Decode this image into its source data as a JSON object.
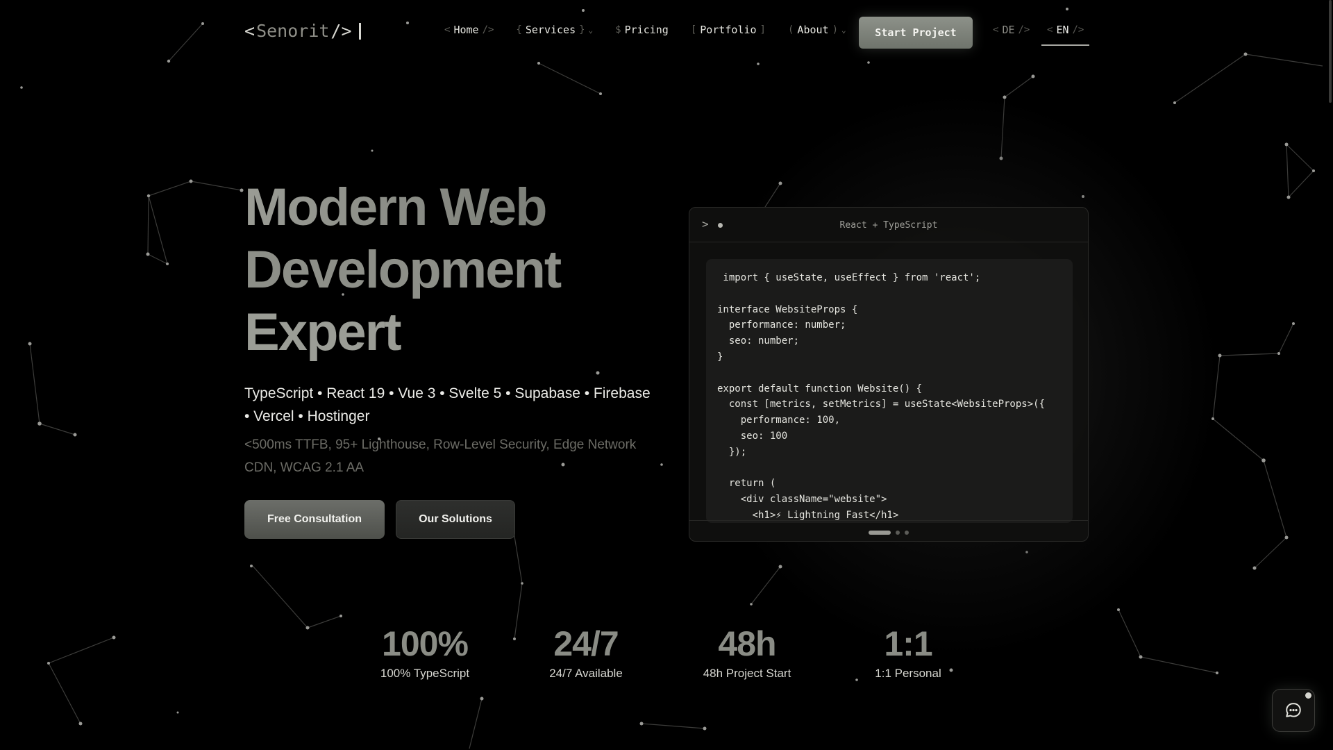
{
  "logo": {
    "open": "<",
    "name": "Senorit",
    "close": "/>"
  },
  "nav": {
    "items": [
      {
        "pre": "<",
        "label": "Home",
        "post": "/>"
      },
      {
        "pre": "{",
        "label": "Services",
        "post": "}"
      },
      {
        "pre": "$",
        "label": "Pricing",
        "post": ""
      },
      {
        "pre": "[",
        "label": "Portfolio",
        "post": "]"
      },
      {
        "pre": "(",
        "label": "About",
        "post": ")"
      }
    ],
    "cta": "Start Project",
    "lang": [
      {
        "pre": "<",
        "label": "DE",
        "post": "/>"
      },
      {
        "pre": "<",
        "label": "EN",
        "post": "/>"
      }
    ]
  },
  "hero": {
    "title_lines": [
      "Modern Web",
      "Development",
      "Expert"
    ],
    "tech": "TypeScript • React 19 • Vue 3 • Svelte 5 • Supabase • Firebase • Vercel • Hostinger",
    "metrics": "<500ms TTFB, 95+ Lighthouse, Row-Level Security, Edge Network CDN, WCAG 2.1 AA",
    "primary_button": "Free Consultation",
    "secondary_button": "Our Solutions"
  },
  "code": {
    "chevron": ">",
    "title": "React + TypeScript",
    "lines": [
      " import { useState, useEffect } from 'react';",
      "",
      "interface WebsiteProps {",
      "  performance: number;",
      "  seo: number;",
      "}",
      "",
      "export default function Website() {",
      "  const [metrics, setMetrics] = useState<WebsiteProps>({",
      "    performance: 100,",
      "    seo: 100",
      "  });",
      "",
      "  return (",
      "    <div className=\"website\">",
      "      <h1>⚡ Lightning Fast</h1>"
    ]
  },
  "stats": [
    {
      "value": "100%",
      "label": "100% TypeScript"
    },
    {
      "value": "24/7",
      "label": "24/7 Available"
    },
    {
      "value": "48h",
      "label": "48h Project Start"
    },
    {
      "value": "1:1",
      "label": "1:1 Personal"
    }
  ],
  "icons": {
    "chat": "chat-bubble-icon",
    "dropdown": "chevron-down-icon"
  },
  "colors": {
    "background": "#000000",
    "accent_button": "#7e827a",
    "text": "#e8e8e4",
    "muted": "#6c6c66"
  }
}
